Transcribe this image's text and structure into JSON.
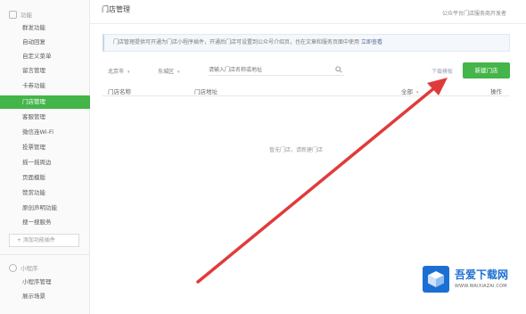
{
  "sidebar": {
    "section_top": "功能",
    "items": [
      "群发功能",
      "自动回复",
      "自定义菜单",
      "留言管理",
      "卡券功能",
      "门店管理",
      "客服管理",
      "微信连Wi-Fi",
      "投票管理",
      "摇一摇周边",
      "页面模版",
      "赞赏功能",
      "原创声明功能",
      "搜一搜服务"
    ],
    "add_plugin": "+ 添加功能插件",
    "section_bottom": "小程序",
    "bottom_items": [
      "小程序管理",
      "展示场景"
    ]
  },
  "header": {
    "title": "门店管理",
    "top_right": "公众平台门店服务商开发者"
  },
  "notice": {
    "text": "门店管理提供可开通为门店小程序插件，开通后门店可设置到公众号介绍页，也在文章和服务页面中使用",
    "link": "立即查看"
  },
  "filters": {
    "province": "北京市",
    "district": "东城区",
    "search_placeholder": "请输入门店名称或地址"
  },
  "actions": {
    "download": "下载模板",
    "add_store": "新建门店"
  },
  "table": {
    "columns": [
      "门店名称",
      "门店地址",
      "全部",
      "操作"
    ],
    "empty_text": "暂无门店，请新建门店"
  },
  "watermark": {
    "title": "吾爱下载网",
    "url": "WWW.WAIXIAZAI.COM"
  },
  "colors": {
    "accent": "#44b549",
    "arrow": "#e03b3b",
    "watermark": "#1b6fd2"
  }
}
